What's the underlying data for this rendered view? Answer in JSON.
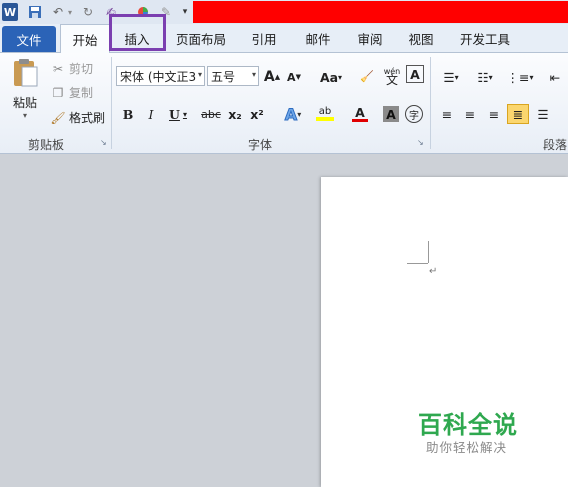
{
  "qat": {
    "icons": [
      "word-app-icon",
      "save-icon",
      "undo-icon",
      "redo-icon",
      "format-painter-icon",
      "color-icon",
      "pen-icon",
      "customize-qat-icon"
    ],
    "word_letter": "W"
  },
  "tabs": [
    {
      "label": "文件"
    },
    {
      "label": "开始"
    },
    {
      "label": "插入"
    },
    {
      "label": "页面布局"
    },
    {
      "label": "引用"
    },
    {
      "label": "邮件"
    },
    {
      "label": "审阅"
    },
    {
      "label": "视图"
    },
    {
      "label": "开发工具"
    }
  ],
  "clipboard": {
    "paste_label": "粘贴",
    "cut_label": "剪切",
    "copy_label": "复制",
    "format_painter_label": "格式刷",
    "group_label": "剪贴板"
  },
  "font": {
    "font_name": "宋体 (中文正3",
    "font_size": "五号",
    "group_label": "字体",
    "grow_label": "A",
    "shrink_label": "A",
    "change_case_label": "Aa",
    "bold_label": "B",
    "italic_label": "I",
    "underline_label": "U",
    "strike_label": "abc",
    "subscript_label": "x₂",
    "superscript_label": "x²",
    "effects_label": "A",
    "highlight_label": "ab",
    "font_color_label": "A",
    "char_shading_label": "A",
    "enclose_label": "字",
    "phonetic_label": "wén",
    "clear_label": "A"
  },
  "paragraph": {
    "group_label": "段落"
  },
  "document": {
    "paragraph_mark": "↵"
  },
  "watermark": {
    "title": "百科全说",
    "subtitle": "助你轻松解决"
  },
  "colors": {
    "file_tab": "#2b63b7",
    "highlight_box": "#7b3fb0",
    "title_bar_red": "#ff0000",
    "watermark_green": "#2fa84f"
  }
}
